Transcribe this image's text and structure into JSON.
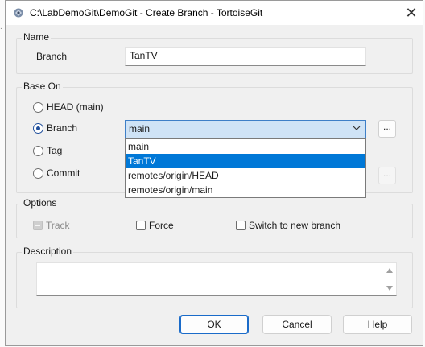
{
  "window": {
    "title": "C:\\LabDemoGit\\DemoGit - Create Branch - TortoiseGit"
  },
  "name_group": {
    "legend": "Name",
    "branch_label": "Branch",
    "branch_value": "TanTV"
  },
  "base_group": {
    "legend": "Base On",
    "options": {
      "head": "HEAD (main)",
      "branch": "Branch",
      "tag": "Tag",
      "commit": "Commit"
    },
    "selected": "branch",
    "branch_combo_value": "main",
    "dropdown_items": [
      "main",
      "TanTV",
      "remotes/origin/HEAD",
      "remotes/origin/main"
    ],
    "dropdown_highlighted": "TanTV",
    "browse_label": "..."
  },
  "options_group": {
    "legend": "Options",
    "track_label": "Track",
    "force_label": "Force",
    "switch_label": "Switch to new branch"
  },
  "description_group": {
    "legend": "Description",
    "text": ""
  },
  "buttons": {
    "ok": "OK",
    "cancel": "Cancel",
    "help": "Help"
  },
  "colors": {
    "accent": "#0078d7",
    "combo_bg": "#cfe3f6"
  }
}
